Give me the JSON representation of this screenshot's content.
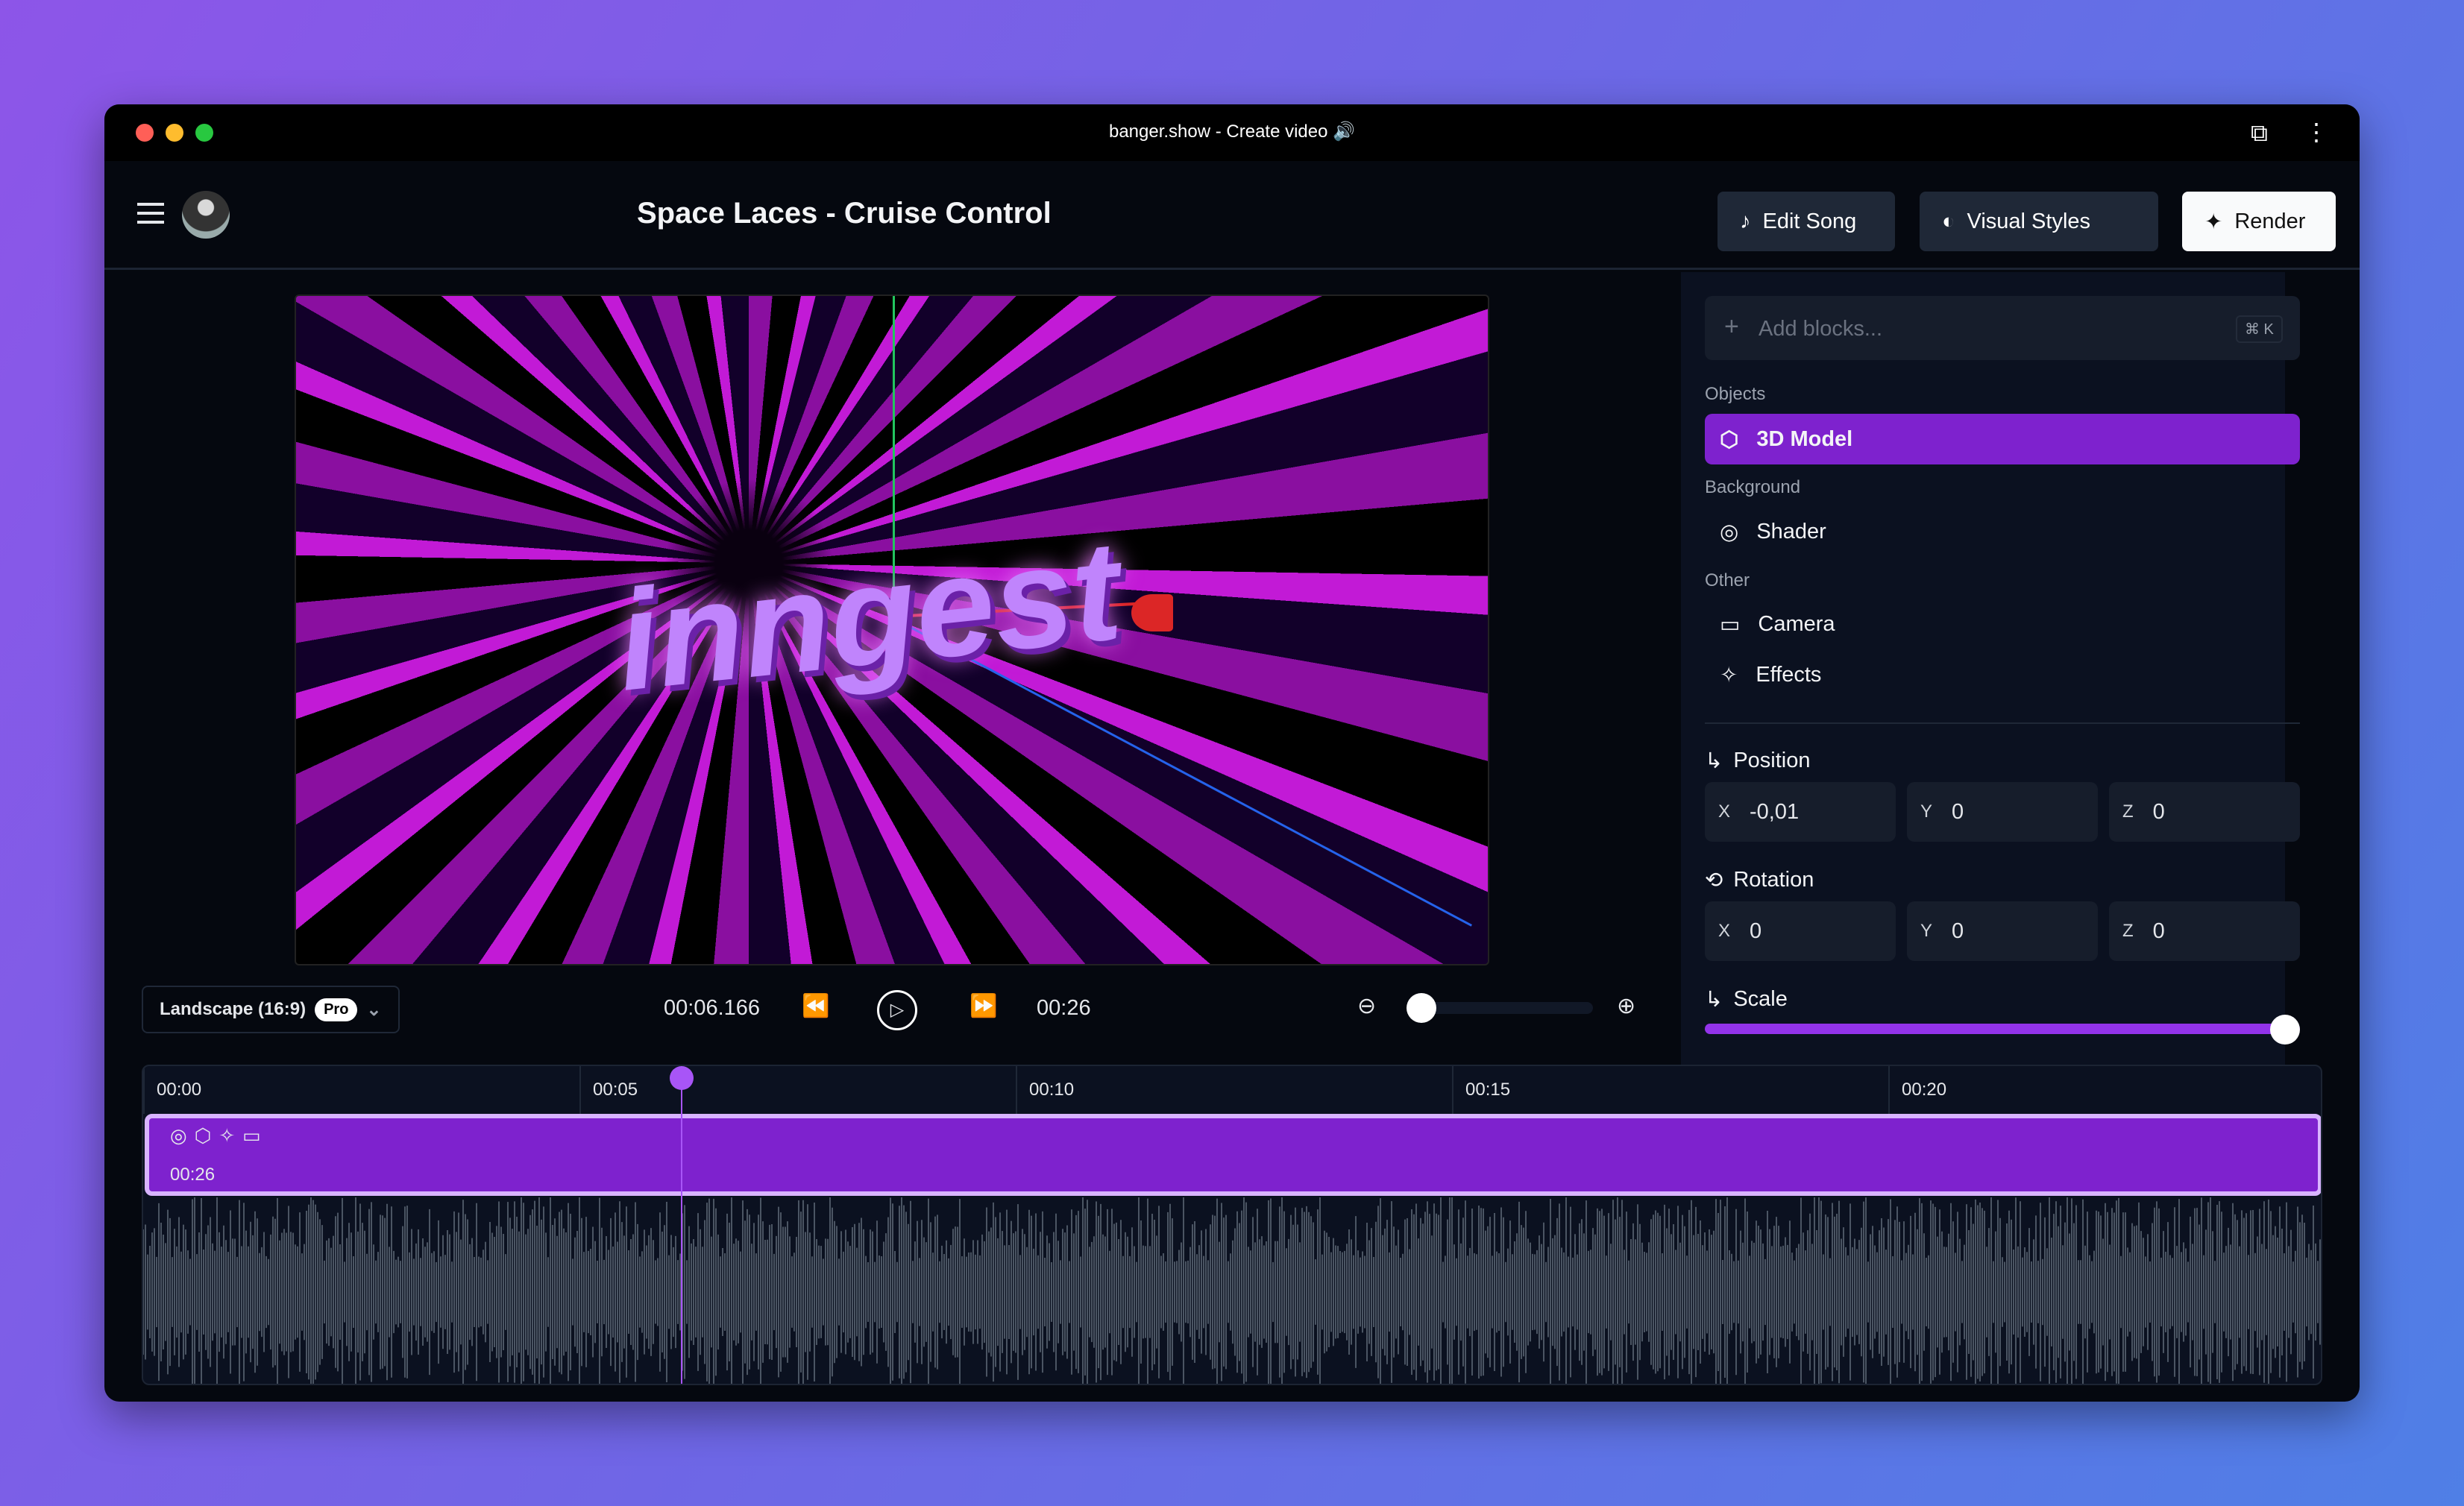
{
  "window": {
    "title": "banger.show - Create video 🔊"
  },
  "header": {
    "song_title": "Space Laces - Cruise Control",
    "edit_song": "Edit Song",
    "visual_styles": "Visual Styles",
    "render": "Render"
  },
  "panel": {
    "add_blocks_placeholder": "Add blocks...",
    "shortcut": "⌘ K",
    "sections": {
      "objects": "Objects",
      "background": "Background",
      "other": "Other"
    },
    "items": {
      "model": "3D Model",
      "shader": "Shader",
      "camera": "Camera",
      "effects": "Effects"
    },
    "position": {
      "label": "Position",
      "x": "-0,01",
      "y": "0",
      "z": "0"
    },
    "rotation": {
      "label": "Rotation",
      "x": "0",
      "y": "0",
      "z": "0"
    },
    "scale": {
      "label": "Scale",
      "value_fraction": 1.0
    },
    "axes": {
      "x": "X",
      "y": "Y",
      "z": "Z"
    },
    "accent": "#7e22ce"
  },
  "preview": {
    "overlay_text": "inngest"
  },
  "controls": {
    "aspect": "Landscape (16:9)",
    "pro_badge": "Pro",
    "current_time": "00:06.166",
    "duration": "00:26",
    "zoom_fraction": 0.0
  },
  "timeline": {
    "ticks": [
      "00:00",
      "00:05",
      "00:10",
      "00:15",
      "00:20"
    ],
    "clip_duration": "00:26",
    "playhead_seconds": 6.166
  }
}
